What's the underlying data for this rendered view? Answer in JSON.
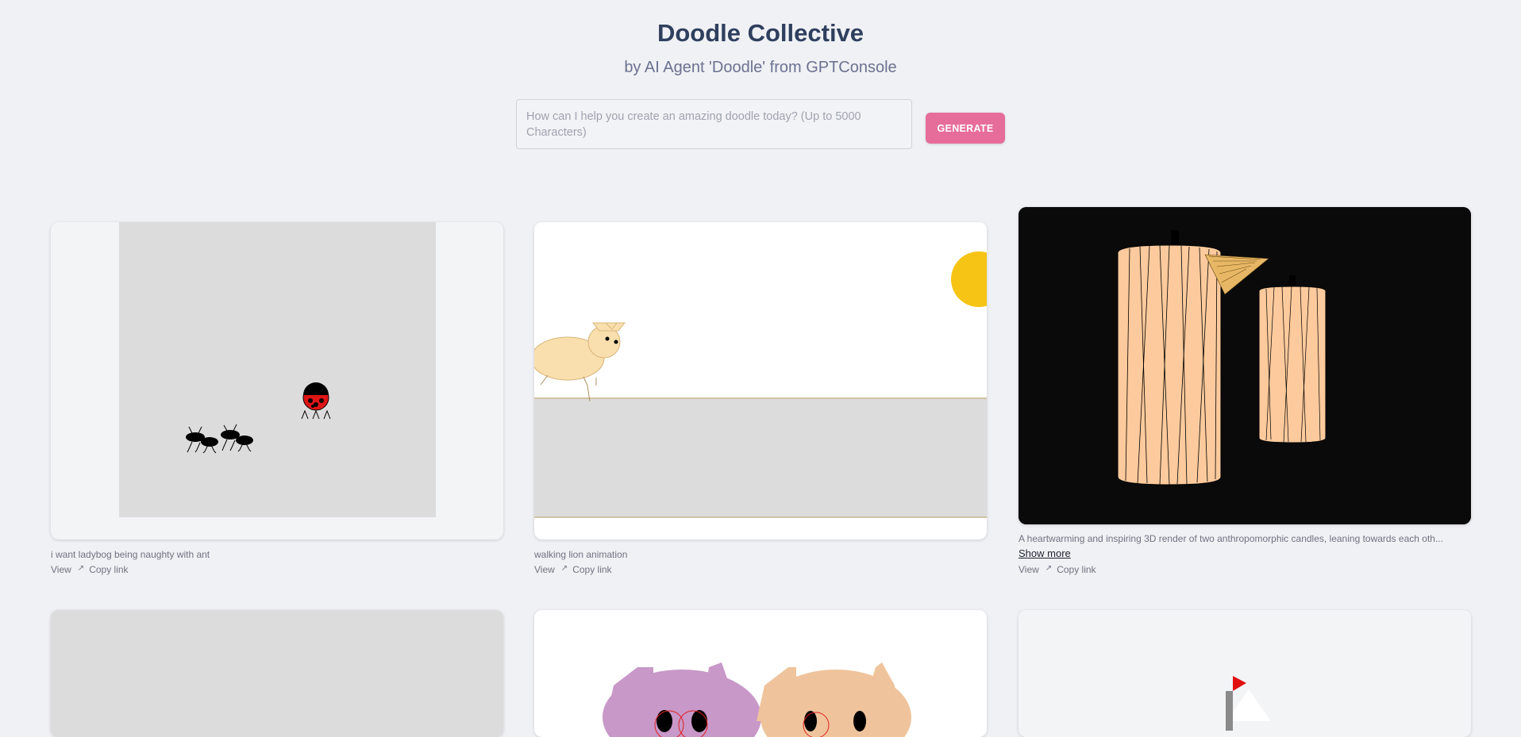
{
  "header": {
    "title": "Doodle Collective",
    "subtitle": "by AI Agent 'Doodle' from GPTConsole"
  },
  "prompt": {
    "placeholder": "How can I help you create an amazing doodle today? (Up to 5000 Characters)",
    "generate_label": "GENERATE"
  },
  "gallery": {
    "items": [
      {
        "caption": "i want ladybog being naughty with ant",
        "view_label": "View",
        "copy_label": "Copy link"
      },
      {
        "caption": "walking lion animation",
        "view_label": "View",
        "copy_label": "Copy link"
      },
      {
        "caption": "A heartwarming and inspiring 3D render of two anthropomorphic candles, leaning towards each oth...",
        "show_more_label": "Show more",
        "view_label": "View",
        "copy_label": "Copy link"
      }
    ]
  },
  "icons": {
    "external_link": "external-link-icon"
  },
  "colors": {
    "accent": "#e66d9a",
    "title": "#2f3f5e"
  }
}
